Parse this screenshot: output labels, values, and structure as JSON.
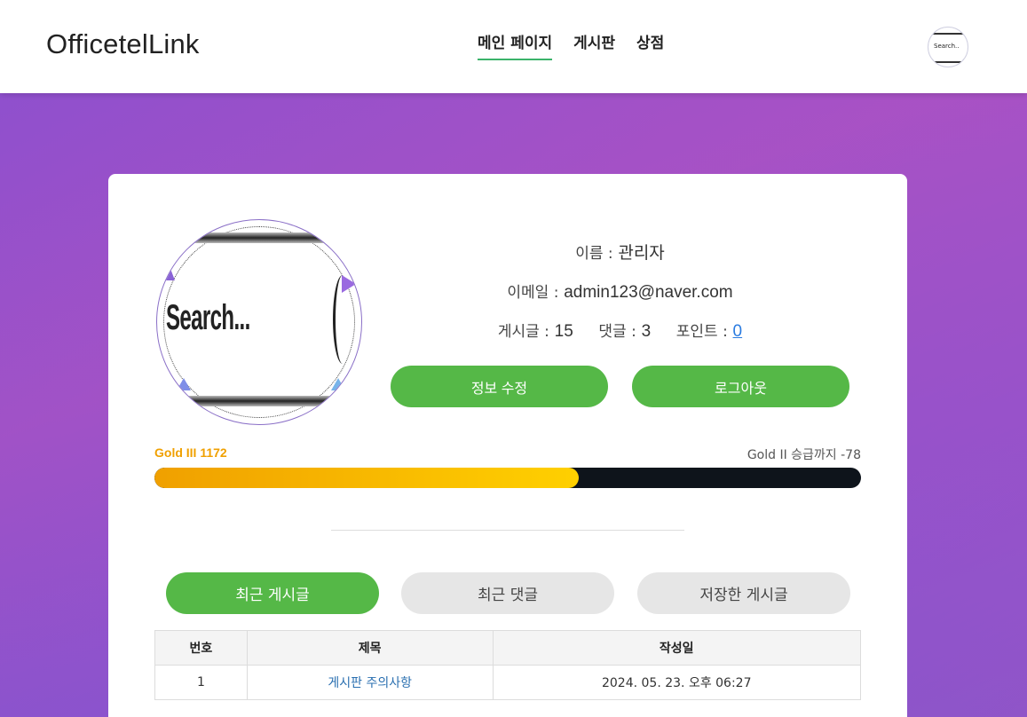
{
  "brand": "OfficetelLink",
  "nav": [
    {
      "label": "메인 페이지",
      "active": true
    },
    {
      "label": "게시판",
      "active": false
    },
    {
      "label": "상점",
      "active": false
    }
  ],
  "header_avatar": {
    "text": "Search.."
  },
  "profile_avatar": {
    "text": "Search..."
  },
  "profile": {
    "name_label": "이름 :",
    "name_value": "관리자",
    "email_label": "이메일 :",
    "email_value": "admin123@naver.com",
    "posts_label": "게시글 :",
    "posts_value": "15",
    "comments_label": "댓글 :",
    "comments_value": "3",
    "points_label": "포인트 :",
    "points_value": "0"
  },
  "buttons": {
    "edit": "정보 수정",
    "logout": "로그아웃"
  },
  "tier": {
    "current": "Gold III 1172",
    "next": "Gold II 승급까지 -78",
    "progress_fraction": 0.6
  },
  "tabs": [
    {
      "label": "최근 게시글",
      "active": true
    },
    {
      "label": "최근 댓글",
      "active": false
    },
    {
      "label": "저장한 게시글",
      "active": false
    }
  ],
  "table": {
    "headers": [
      "번호",
      "제목",
      "작성일"
    ],
    "rows": [
      {
        "no": "1",
        "title": "게시판 주의사항",
        "date": "2024. 05. 23. 오후 06:27"
      }
    ]
  },
  "colors": {
    "accent_green": "#55b847",
    "tier_gold": "#f0a000",
    "link_blue": "#2a6fb0"
  }
}
